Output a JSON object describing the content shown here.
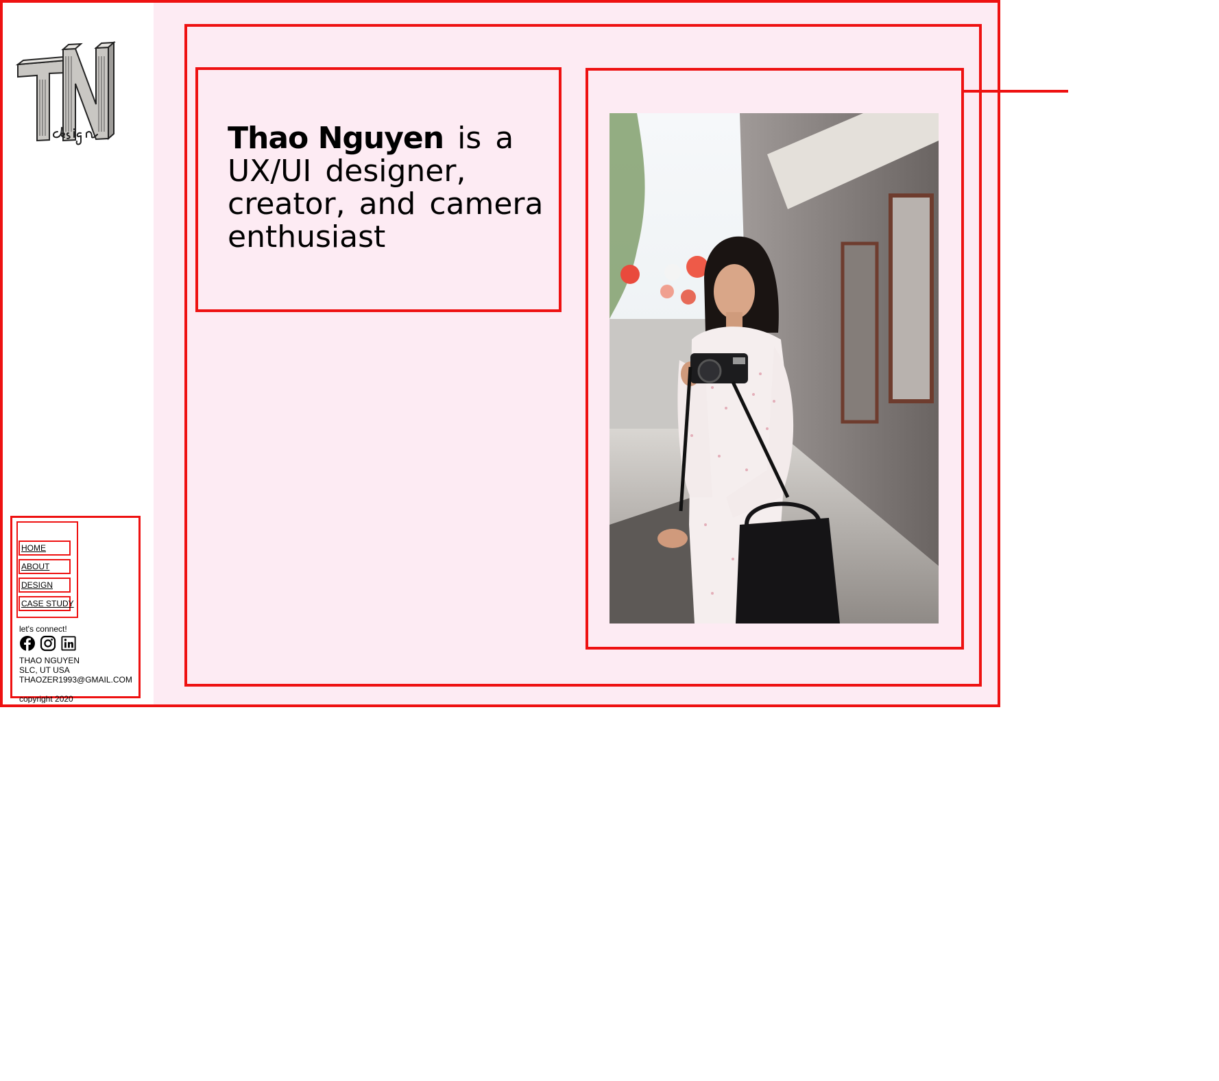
{
  "headline": {
    "name": "Thao Nguyen",
    "rest": " is a UX/UI designer, creator, and camera enthusiast"
  },
  "logo": {
    "letters": "TN",
    "script": "design"
  },
  "nav": {
    "items": [
      {
        "label": "HOME"
      },
      {
        "label": "ABOUT"
      },
      {
        "label": "DESIGN"
      },
      {
        "label": "CASE STUDY"
      }
    ]
  },
  "connect": {
    "label": "let's connect!",
    "icons": [
      "facebook-icon",
      "instagram-icon",
      "linkedin-icon"
    ]
  },
  "contact": {
    "name": "THAO NGUYEN",
    "location": "SLC, UT USA",
    "email": "THAOZER1993@GMAIL.COM"
  },
  "copyright": "copyright 2020",
  "colors": {
    "page_background": "#fdebf3",
    "sidebar_background": "#ffffff",
    "outline": "#ee1111",
    "text": "#000000"
  }
}
